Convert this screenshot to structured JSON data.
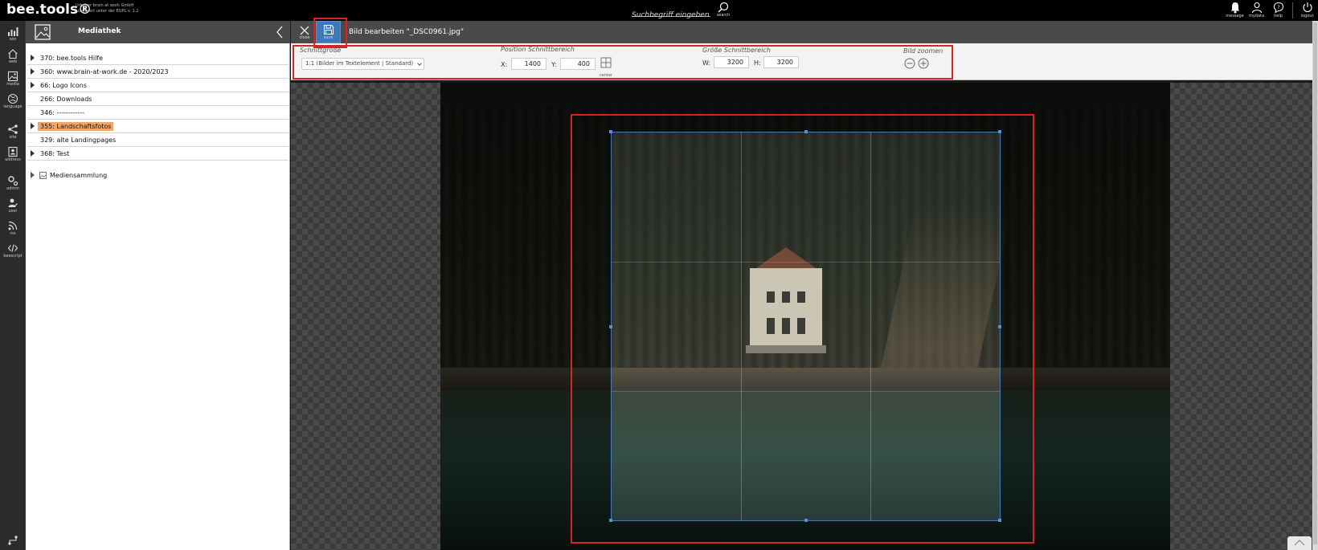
{
  "app": {
    "brand": "bee.tools®",
    "license_line1": "Urheber brain at work GmbH",
    "license_line2": "Lizensiert unter der EUPL v. 1.2"
  },
  "topbar": {
    "search_placeholder": "Suchbegriff eingeben",
    "search_label": "search",
    "right_items": [
      {
        "label": "message",
        "icon": "bell-icon"
      },
      {
        "label": "mydata",
        "icon": "user-icon"
      },
      {
        "label": "help",
        "icon": "help-icon"
      },
      {
        "label": "logout",
        "icon": "power-icon"
      }
    ]
  },
  "leftnav": {
    "items": [
      {
        "label": "seo",
        "icon": "chart-icon"
      },
      {
        "label": "web",
        "icon": "home-icon"
      },
      {
        "label": "media",
        "icon": "image-icon"
      },
      {
        "label": "language",
        "icon": "language-icon"
      },
      {
        "label": "site",
        "icon": "sitemap-icon"
      },
      {
        "label": "address",
        "icon": "address-icon"
      },
      {
        "label": "admin",
        "icon": "gears-icon"
      },
      {
        "label": "user",
        "icon": "user-edit-icon"
      },
      {
        "label": "rss",
        "icon": "rss-icon"
      },
      {
        "label": "beescript",
        "icon": "code-icon"
      }
    ]
  },
  "media_panel": {
    "title": "Mediathek",
    "tree": [
      {
        "label": "370: bee.tools Hilfe",
        "expandable": true,
        "selected": false
      },
      {
        "label": "360: www.brain-at-work.de - 2020/2023",
        "expandable": true,
        "selected": false
      },
      {
        "label": "66: Logo Icons",
        "expandable": true,
        "selected": false
      },
      {
        "label": "266: Downloads",
        "expandable": false,
        "selected": false
      },
      {
        "label": "346: ------------",
        "expandable": false,
        "selected": false
      },
      {
        "label": "355: Landschaftsfotos",
        "expandable": true,
        "selected": true
      },
      {
        "label": "329: alte Landingpages",
        "expandable": false,
        "selected": false
      },
      {
        "label": "368: Test",
        "expandable": true,
        "selected": false
      }
    ],
    "collection": "Mediensammlung"
  },
  "editor": {
    "close_label": "close",
    "save_label": "save",
    "title": "Bild bearbeiten \"_DSC0961.jpg\""
  },
  "toolbar": {
    "crop_size_label": "Schnittgröße",
    "crop_size_value": "1:1 (Bilder im Textelement | Standard)",
    "position_label": "Position Schnittbereich",
    "x_label": "X:",
    "x_value": "1400",
    "y_label": "Y:",
    "y_value": "400",
    "center_label": "center",
    "size_label": "Größe Schnittbereich",
    "w_label": "W:",
    "w_value": "3200",
    "h_label": "H:",
    "h_value": "3200",
    "zoom_label": "Bild zoomen"
  },
  "colors": {
    "highlight": "#d42424",
    "selected_bg": "#f0a66a",
    "save_bg": "#3d78b8"
  }
}
